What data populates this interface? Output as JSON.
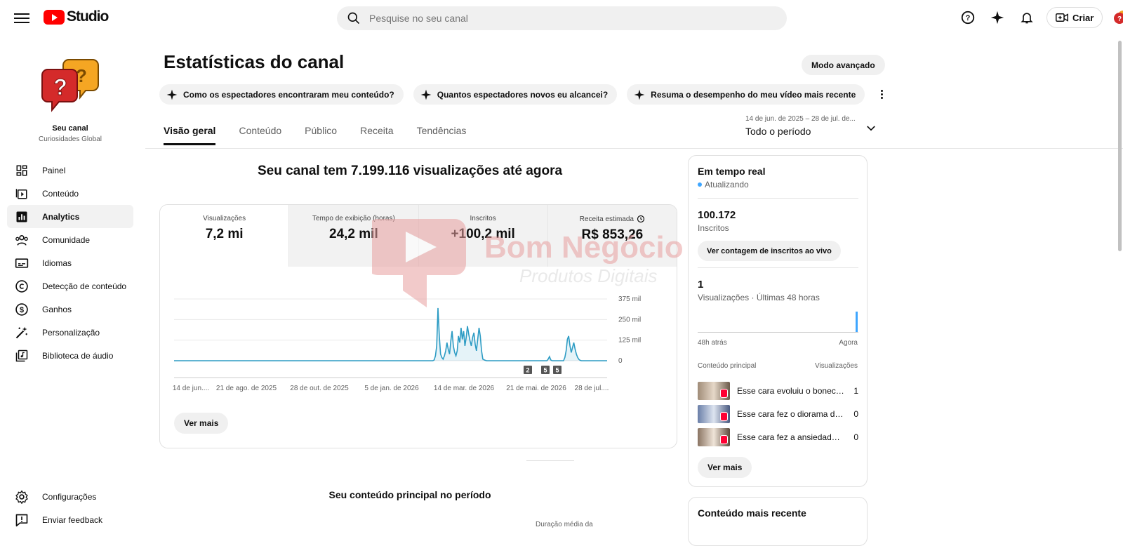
{
  "header": {
    "logo_text": "Studio",
    "search_placeholder": "Pesquise no seu canal",
    "create_label": "Criar"
  },
  "sidebar": {
    "channel_label": "Seu canal",
    "channel_name": "Curiosidades Global",
    "items": [
      {
        "label": "Painel",
        "icon": "dashboard-icon"
      },
      {
        "label": "Conteúdo",
        "icon": "content-icon"
      },
      {
        "label": "Analytics",
        "icon": "analytics-icon",
        "active": true
      },
      {
        "label": "Comunidade",
        "icon": "community-icon"
      },
      {
        "label": "Idiomas",
        "icon": "subtitles-icon"
      },
      {
        "label": "Detecção de conteúdo",
        "icon": "copyright-icon"
      },
      {
        "label": "Ganhos",
        "icon": "earn-icon"
      },
      {
        "label": "Personalização",
        "icon": "magic-wand-icon"
      },
      {
        "label": "Biblioteca de áudio",
        "icon": "audio-library-icon"
      }
    ],
    "bottom": [
      {
        "label": "Configurações",
        "icon": "settings-icon"
      },
      {
        "label": "Enviar feedback",
        "icon": "feedback-icon"
      }
    ]
  },
  "page": {
    "title": "Estatísticas do canal",
    "advanced_mode": "Modo avançado",
    "chips": [
      "Como os espectadores encontraram meu conteúdo?",
      "Quantos espectadores novos eu alcancei?",
      "Resuma o desempenho do meu vídeo mais recente"
    ],
    "tabs": [
      "Visão geral",
      "Conteúdo",
      "Público",
      "Receita",
      "Tendências"
    ],
    "period_range": "14 de jun. de 2025 – 28 de jul. de...",
    "period_label": "Todo o período",
    "headline": "Seu canal tem 7.199.116 visualizações até agora",
    "see_more": "Ver mais",
    "top_content_title": "Seu conteúdo principal no período",
    "col_header_partial": "Duração média da"
  },
  "metrics": [
    {
      "label": "Visualizações",
      "value": "7,2 mi"
    },
    {
      "label": "Tempo de exibição (horas)",
      "value": "24,2 mil"
    },
    {
      "label": "Inscritos",
      "value": "+100,2 mil"
    },
    {
      "label": "Receita estimada",
      "value": "R$ 853,26"
    }
  ],
  "chart_data": {
    "type": "line",
    "x_ticks": [
      "14 de jun....",
      "21 de ago. de 2025",
      "28 de out. de 2025",
      "5 de jan. de 2026",
      "14 de mar. de 2026",
      "21 de mai. de 2026",
      "28 de jul...."
    ],
    "y_ticks": [
      "375 mil",
      "250 mil",
      "125 mil",
      "0"
    ],
    "ylim": [
      0,
      375000
    ],
    "series": [
      {
        "values": [
          0,
          0,
          0,
          0,
          0,
          0,
          0,
          0,
          0,
          0,
          0,
          0,
          0,
          0,
          0,
          0,
          0,
          0,
          0,
          0,
          0,
          0,
          0,
          0,
          0,
          0,
          0,
          0,
          0,
          0,
          0,
          0,
          0,
          0,
          0,
          0,
          0,
          0,
          0,
          0,
          0,
          0,
          0,
          0,
          0,
          0,
          0,
          0,
          0,
          0,
          0,
          0,
          0,
          0,
          0,
          0,
          0,
          0,
          0,
          0,
          0,
          0,
          0,
          0,
          0,
          0,
          0,
          0,
          0,
          0,
          0,
          0,
          0,
          0,
          0,
          0,
          0,
          0,
          0,
          0,
          0,
          0,
          0,
          0,
          0,
          0,
          0,
          0,
          0,
          0,
          0,
          0,
          0,
          0,
          0,
          0,
          0,
          0,
          0,
          0,
          0,
          0,
          0,
          0,
          0,
          0,
          0,
          0,
          0,
          0,
          0,
          0,
          0,
          0,
          0,
          0,
          0,
          0,
          0,
          0,
          0,
          0,
          0,
          0,
          0,
          0,
          0,
          0,
          0,
          0,
          0,
          0,
          0,
          0,
          0,
          0,
          0,
          0,
          0,
          0,
          0,
          0,
          0,
          0,
          0,
          0,
          0,
          0,
          0,
          0,
          0,
          0,
          0,
          0,
          0,
          0,
          0,
          0,
          0,
          0,
          0,
          0,
          0,
          0,
          0,
          0,
          0,
          0,
          0,
          0,
          0,
          0,
          0,
          0,
          0,
          0,
          0,
          0,
          0,
          0,
          0,
          0,
          0,
          0,
          0,
          0,
          0,
          0,
          0,
          0,
          0,
          0,
          0,
          0,
          0,
          0,
          0,
          0,
          0,
          0,
          0,
          0,
          0,
          5000,
          30000,
          90000,
          320000,
          150000,
          40000,
          20000,
          10000,
          30000,
          60000,
          110000,
          70000,
          40000,
          120000,
          180000,
          90000,
          50000,
          30000,
          60000,
          150000,
          110000,
          200000,
          130000,
          180000,
          90000,
          140000,
          210000,
          160000,
          120000,
          90000,
          140000,
          170000,
          100000,
          60000,
          130000,
          200000,
          150000,
          60000,
          10000,
          5000,
          2000,
          0,
          0,
          0,
          0,
          0,
          0,
          0,
          0,
          0,
          0,
          0,
          0,
          0,
          0,
          0,
          0,
          0,
          0,
          0,
          0,
          0,
          0,
          0,
          0,
          0,
          0,
          0,
          0,
          0,
          0,
          0,
          0,
          0,
          0,
          0,
          0,
          0,
          0,
          0,
          0,
          0,
          0,
          0,
          0,
          0,
          0,
          0,
          0,
          10000,
          25000,
          5000,
          0,
          0,
          0,
          0,
          0,
          0,
          0,
          0,
          0,
          0,
          20000,
          60000,
          130000,
          150000,
          90000,
          50000,
          80000,
          110000,
          70000,
          40000,
          20000,
          8000,
          2000,
          0,
          0,
          0,
          0,
          0,
          0,
          0,
          0,
          0,
          0,
          0,
          0,
          0,
          0,
          0,
          0,
          0,
          0,
          0,
          0,
          0
        ]
      }
    ],
    "annotations": [
      "2",
      "5",
      "5"
    ],
    "grid": true
  },
  "realtime": {
    "title": "Em tempo real",
    "status": "Atualizando",
    "subs_value": "100.172",
    "subs_label": "Inscritos",
    "live_count_button": "Ver contagem de inscritos ao vivo",
    "views_value": "1",
    "views_label": "Visualizações · Últimas 48 horas",
    "axis_left": "48h atrás",
    "axis_right": "Agora",
    "col_left": "Conteúdo principal",
    "col_right": "Visualizações",
    "rows": [
      {
        "title": "Esse cara evoluiu o boneco de...",
        "count": "1"
      },
      {
        "title": "Esse cara fez o diorama do...",
        "count": "0"
      },
      {
        "title": "Esse cara fez a ansiedade de...",
        "count": "0"
      }
    ],
    "see_more": "Ver mais"
  },
  "recent": {
    "title": "Conteúdo mais recente"
  },
  "watermark": {
    "line1": "Bom Negócio",
    "line2": "Produtos Digitais"
  },
  "colors": {
    "accent": "#3ea6ff",
    "chart_line": "#2d9cc4",
    "brand_red": "#ff0000"
  }
}
